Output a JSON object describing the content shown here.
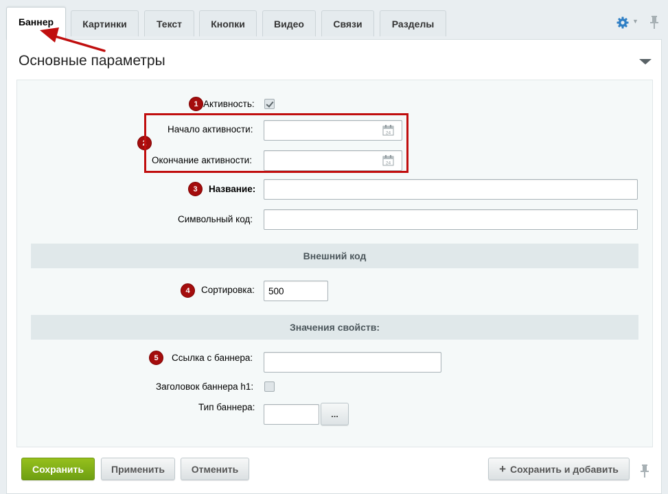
{
  "tabs": [
    {
      "label": "Баннер",
      "active": true
    },
    {
      "label": "Картинки"
    },
    {
      "label": "Текст"
    },
    {
      "label": "Кнопки"
    },
    {
      "label": "Видео"
    },
    {
      "label": "Связи"
    },
    {
      "label": "Разделы"
    }
  ],
  "section": {
    "title": "Основные параметры"
  },
  "fields": {
    "active": {
      "label": "Активность:",
      "checked": true,
      "badge": "1"
    },
    "active_from": {
      "label": "Начало активности:",
      "value": ""
    },
    "active_to": {
      "label": "Окончание активности:",
      "value": ""
    },
    "dates_badge": "2",
    "name": {
      "label": "Название:",
      "value": "",
      "badge": "3"
    },
    "code": {
      "label": "Символьный код:",
      "value": ""
    },
    "external_code_group": "Внешний код",
    "sort": {
      "label": "Сортировка:",
      "value": "500",
      "badge": "4"
    },
    "props_group": "Значения свойств:",
    "banner_link": {
      "label": "Ссылка с баннера:",
      "value": "",
      "badge": "5"
    },
    "banner_h1": {
      "label": "Заголовок баннера h1:",
      "checked": false
    },
    "banner_type": {
      "label": "Тип баннера:",
      "value": "",
      "picker": "..."
    }
  },
  "buttons": {
    "save": "Сохранить",
    "apply": "Применить",
    "cancel": "Отменить",
    "save_and_add": "Сохранить и добавить"
  },
  "colors": {
    "accent_green": "#7fad16",
    "badge_red": "#a40d0d",
    "highlight_red": "#c00e0e",
    "gear_blue": "#2f7fc5"
  },
  "icons": [
    "settings-gear-icon",
    "pin-icon",
    "calendar-icon",
    "plus-icon",
    "collapse-arrow-icon"
  ]
}
